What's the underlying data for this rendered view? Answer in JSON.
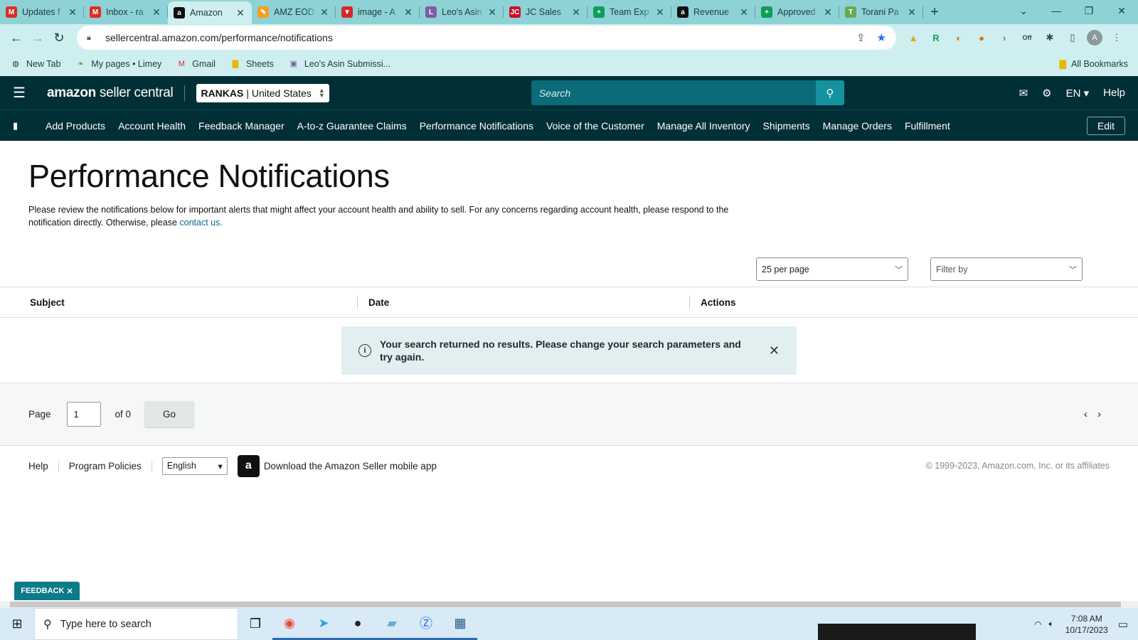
{
  "browser": {
    "tabs": [
      {
        "title": "Updates f",
        "icon": "gmail-icon",
        "color": "#d93025",
        "glyph": "M"
      },
      {
        "title": "Inbox - ra",
        "icon": "gmail-icon",
        "color": "#d93025",
        "glyph": "M"
      },
      {
        "title": "Amazon",
        "icon": "amazon-icon",
        "color": "#111111",
        "glyph": "a",
        "active": true
      },
      {
        "title": "AMZ EOD",
        "icon": "pencil-icon",
        "color": "#f4a020",
        "glyph": "✎"
      },
      {
        "title": "image - A",
        "icon": "vivaldi-icon",
        "color": "#d42a2a",
        "glyph": "▼"
      },
      {
        "title": "Leo's Asin",
        "icon": "doc-icon",
        "color": "#7b5ea7",
        "glyph": "L"
      },
      {
        "title": "JC Sales",
        "icon": "jc-icon",
        "color": "#c8102e",
        "glyph": "JC"
      },
      {
        "title": "Team Exp",
        "icon": "sheets-icon",
        "color": "#0f9d58",
        "glyph": "+"
      },
      {
        "title": "Revenue",
        "icon": "amazon-icon",
        "color": "#111111",
        "glyph": "a"
      },
      {
        "title": "Approved",
        "icon": "sheets-icon",
        "color": "#0f9d58",
        "glyph": "+"
      },
      {
        "title": "Torani Pa",
        "icon": "torani-icon",
        "color": "#6aa84f",
        "glyph": "T"
      }
    ],
    "url": "sellercentral.amazon.com/performance/notifications",
    "bookmarks": [
      {
        "label": "New Tab",
        "icon": "chrome-icon"
      },
      {
        "label": "My pages • Limey",
        "icon": "leaf-icon"
      },
      {
        "label": "Gmail",
        "icon": "gmail-icon"
      },
      {
        "label": "Sheets",
        "icon": "folder-icon"
      },
      {
        "label": "Leo's Asin Submissi...",
        "icon": "doc-icon"
      }
    ],
    "all_bookmarks": "All Bookmarks",
    "profile_initial": "A"
  },
  "header": {
    "logo_main": "amazon",
    "logo_sub": " seller central",
    "store": "RANKAS",
    "marketplace": "| United States",
    "search_placeholder": "Search",
    "language": "EN",
    "help": "Help"
  },
  "nav": {
    "items": [
      "Add Products",
      "Account Health",
      "Feedback Manager",
      "A-to-z Guarantee Claims",
      "Performance Notifications",
      "Voice of the Customer",
      "Manage All Inventory",
      "Shipments",
      "Manage Orders",
      "Fulfillment"
    ],
    "edit": "Edit"
  },
  "page": {
    "title": "Performance Notifications",
    "intro": "Please review the notifications below for important alerts that might affect your account health and ability to sell. For any concerns regarding account health, please respond to the notification directly. Otherwise, please ",
    "contact_link": "contact us.",
    "per_page": "25 per page",
    "filter_by": "Filter by",
    "columns": [
      "Subject",
      "Date",
      "Actions"
    ],
    "no_results": "Your search returned no results. Please change your search parameters and try again.",
    "pager": {
      "label": "Page",
      "value": "1",
      "of": "of 0",
      "go": "Go"
    }
  },
  "footer": {
    "help": "Help",
    "policies": "Program Policies",
    "language": "English",
    "app": "Download the Amazon Seller mobile app",
    "copyright": "© 1999-2023, Amazon.com, Inc. or its affiliates"
  },
  "feedback": "FEEDBACK",
  "taskbar": {
    "search_placeholder": "Type here to search",
    "time": "7:08 AM",
    "date": "10/17/2023"
  }
}
